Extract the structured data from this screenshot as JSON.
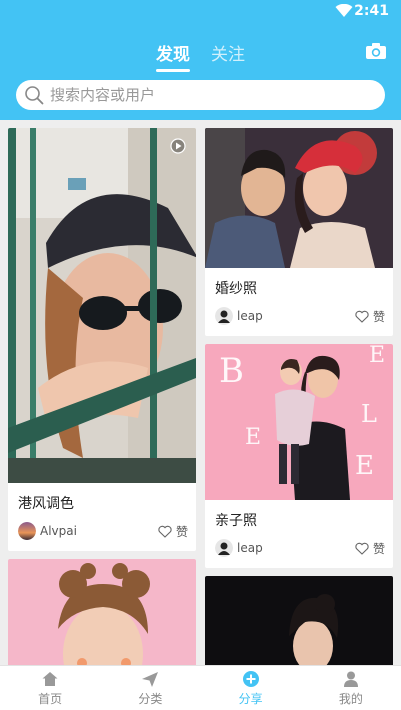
{
  "status_bar": {
    "time": "2:41"
  },
  "header": {
    "tabs": [
      {
        "label": "发现",
        "active": true
      },
      {
        "label": "关注",
        "active": false
      }
    ]
  },
  "search": {
    "placeholder": "搜索内容或用户"
  },
  "feed": {
    "left": [
      {
        "title": "港风调色",
        "author": "Alvpai",
        "like_label": "赞",
        "has_video_badge": true
      },
      {
        "title": "",
        "author": "",
        "like_label": ""
      }
    ],
    "right": [
      {
        "title": "婚纱照",
        "author": "leap",
        "like_label": "赞"
      },
      {
        "title": "亲子照",
        "author": "leap",
        "like_label": "赞"
      },
      {
        "title": "",
        "author": "",
        "like_label": ""
      }
    ]
  },
  "bottom_nav": [
    {
      "label": "首页",
      "icon": "home-icon",
      "active": false
    },
    {
      "label": "分类",
      "icon": "paper-plane-icon",
      "active": false
    },
    {
      "label": "分享",
      "icon": "plus-circle-icon",
      "active": true
    },
    {
      "label": "我的",
      "icon": "person-icon",
      "active": false
    }
  ],
  "colors": {
    "accent": "#43c3f4"
  }
}
